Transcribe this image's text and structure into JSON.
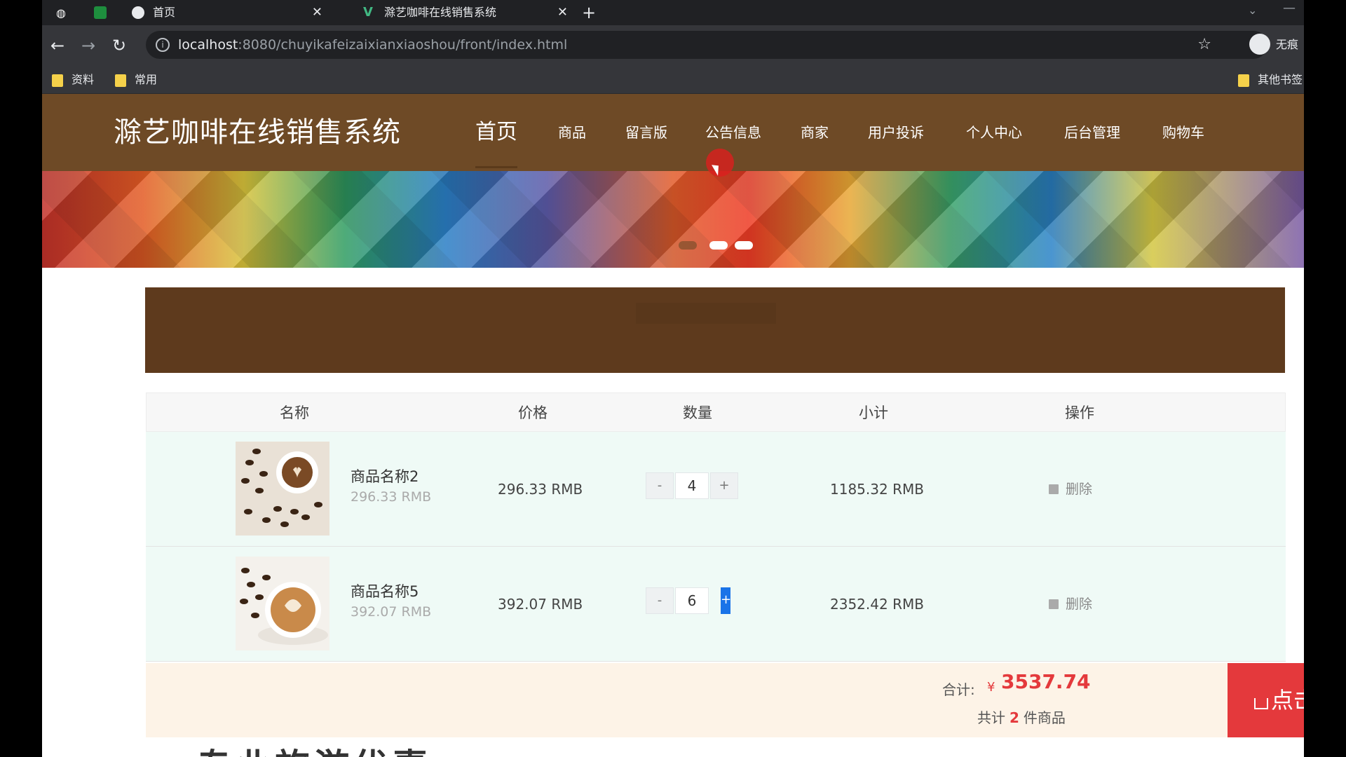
{
  "browser": {
    "tabs": [
      {
        "title": "首页",
        "active": true
      },
      {
        "title": "滁艺咖啡在线销售系统",
        "active": false
      }
    ],
    "new_tab": "+",
    "url_host": "localhost",
    "url_path": ":8080/chuyikafeizaixianxiaoshou/front/index.html",
    "profile_label": "无痕",
    "bookmarks": [
      "资料",
      "常用"
    ],
    "other_bookmarks": "其他书签"
  },
  "site": {
    "title": "滁艺咖啡在线销售系统",
    "nav": [
      "首页",
      "商品",
      "留言版",
      "公告信息",
      "商家",
      "用户投诉",
      "个人中心",
      "后台管理",
      "购物车"
    ]
  },
  "cart": {
    "headers": [
      "名称",
      "价格",
      "数量",
      "小计",
      "操作"
    ],
    "items": [
      {
        "name": "商品名称2",
        "unit_price": "296.33 RMB",
        "price": "296.33 RMB",
        "quantity": "4",
        "subtotal": "1185.32 RMB",
        "delete": "删除",
        "minus": "-",
        "plus": "+"
      },
      {
        "name": "商品名称5",
        "unit_price": "392.07 RMB",
        "price": "392.07 RMB",
        "quantity": "6",
        "subtotal": "2352.42 RMB",
        "delete": "删除",
        "minus": "-",
        "plus": "+"
      }
    ],
    "summary": {
      "label": "合计:",
      "currency": "¥",
      "total": "3537.74",
      "count_prefix": "共计",
      "count": "2",
      "count_suffix": "件商品",
      "checkout": "点击结算"
    }
  },
  "below_text": "专业旅游优惠"
}
